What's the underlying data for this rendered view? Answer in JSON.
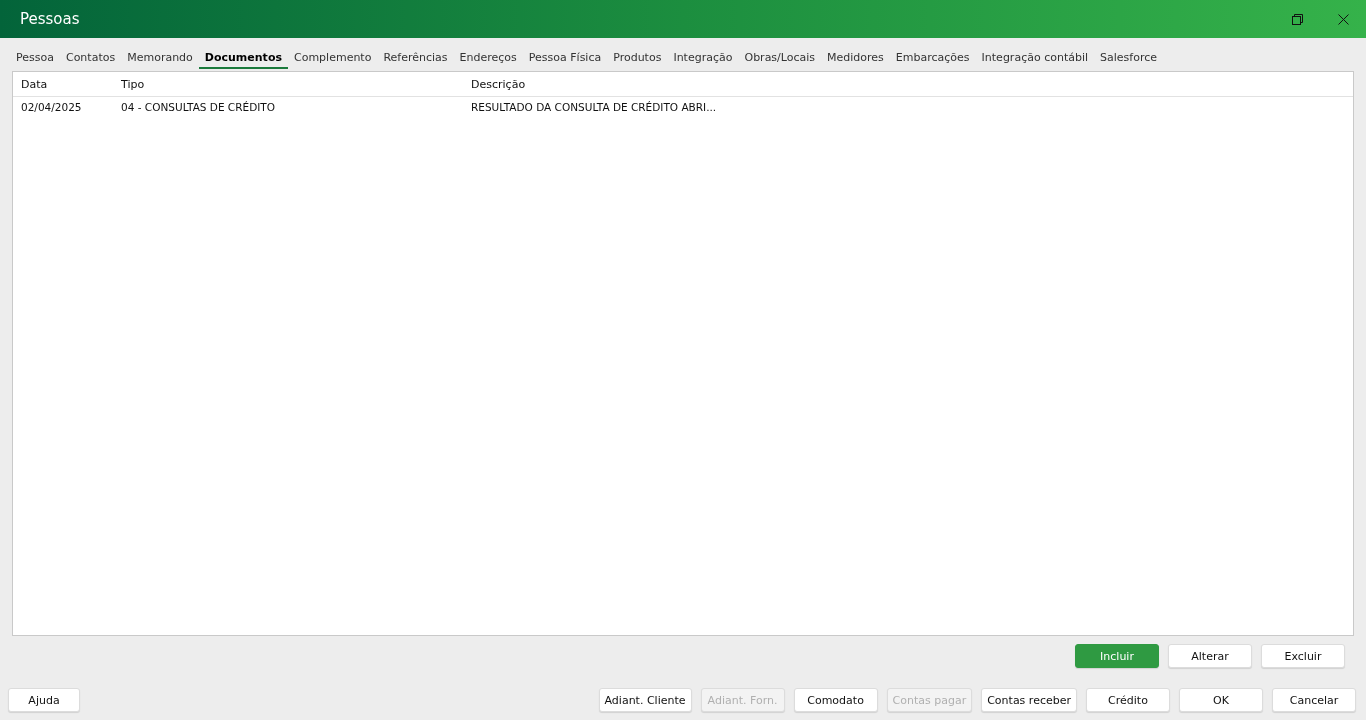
{
  "window": {
    "title": "Pessoas"
  },
  "tabs": [
    {
      "label": "Pessoa",
      "selected": false
    },
    {
      "label": "Contatos",
      "selected": false
    },
    {
      "label": "Memorando",
      "selected": false
    },
    {
      "label": "Documentos",
      "selected": true
    },
    {
      "label": "Complemento",
      "selected": false
    },
    {
      "label": "Referências",
      "selected": false
    },
    {
      "label": "Endereços",
      "selected": false
    },
    {
      "label": "Pessoa Física",
      "selected": false
    },
    {
      "label": "Produtos",
      "selected": false
    },
    {
      "label": "Integração",
      "selected": false
    },
    {
      "label": "Obras/Locais",
      "selected": false
    },
    {
      "label": "Medidores",
      "selected": false
    },
    {
      "label": "Embarcações",
      "selected": false
    },
    {
      "label": "Integração contábil",
      "selected": false
    },
    {
      "label": "Salesforce",
      "selected": false
    }
  ],
  "table": {
    "columns": [
      "Data",
      "Tipo",
      "Descrição"
    ],
    "rows": [
      [
        "02/04/2025",
        "04 - CONSULTAS DE CRÉDITO",
        "RESULTADO DA CONSULTA DE CRÉDITO ABRI..."
      ]
    ]
  },
  "table_actions": [
    {
      "label": "Incluir",
      "primary": true
    },
    {
      "label": "Alterar",
      "primary": false
    },
    {
      "label": "Excluir",
      "primary": false
    }
  ],
  "help_button": {
    "label": "Ajuda"
  },
  "footer_buttons": [
    {
      "label": "Adiant. Cliente",
      "disabled": false
    },
    {
      "label": "Adiant. Forn.",
      "disabled": true
    },
    {
      "label": "Comodato",
      "disabled": false
    },
    {
      "label": "Contas pagar",
      "disabled": true
    },
    {
      "label": "Contas receber",
      "disabled": false
    },
    {
      "label": "Crédito",
      "disabled": false
    },
    {
      "label": "OK",
      "disabled": false
    },
    {
      "label": "Cancelar",
      "disabled": false
    }
  ]
}
